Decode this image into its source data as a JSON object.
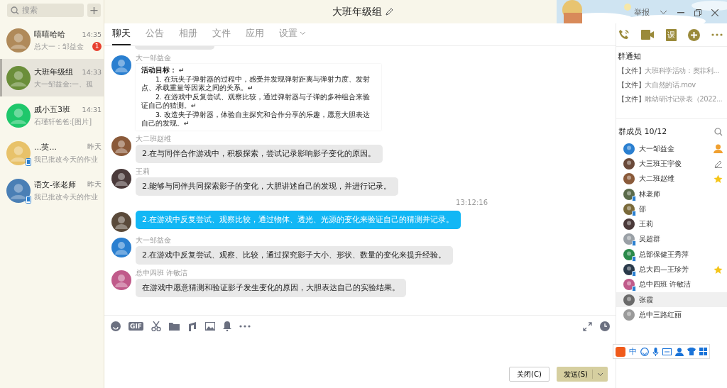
{
  "search": {
    "placeholder": "搜索",
    "add": "+"
  },
  "conversations": [
    {
      "name": "嘻嘻哈哈",
      "time": "14:35",
      "preview": "总大一：邹益金",
      "unread": "1",
      "selected": false,
      "mobile": false,
      "color": "#b08a5a"
    },
    {
      "name": "大班年级组",
      "time": "14:33",
      "preview": "大一邹益金:一、孤",
      "selected": true,
      "mobile": false,
      "color": "#6b8e3a"
    },
    {
      "name": "戚小五3班",
      "time": "14:31",
      "preview": "石瑾轩爸爸:[图片]",
      "selected": false,
      "mobile": false,
      "color": "#1fc76b"
    },
    {
      "name": "...英...",
      "time": "昨天",
      "preview": "我已批改今天的作业",
      "selected": false,
      "mobile": true,
      "color": "#e8c26a"
    },
    {
      "name": "语文-张老师",
      "time": "昨天",
      "preview": "我已批改今天的作业",
      "selected": false,
      "mobile": true,
      "color": "#4a7fb5"
    }
  ],
  "window": {
    "title": "大班年级组",
    "report": "举报"
  },
  "tabs": [
    {
      "label": "聊天",
      "selected": true
    },
    {
      "label": "公告",
      "selected": false
    },
    {
      "label": "相册",
      "selected": false
    },
    {
      "label": "文件",
      "selected": false
    },
    {
      "label": "应用",
      "selected": false
    },
    {
      "label": "设置",
      "selected": false,
      "dropdown": true
    }
  ],
  "header_actions": {
    "course": "课"
  },
  "messages": [
    {
      "kind": "document",
      "sender": "大一邹益金",
      "color": "#2a7fd0",
      "lines": [
        "**活动目标：** ↵",
        "1. 在玩夹子弹射器的过程中，感受并发现弹射距离与弹射力度、发射点、承载重量等因素之间的关系。↵",
        "2. 在游戏中反复尝试、观察比较，通过弹射器与子弹的多种组合来验证自己的猜测。↵",
        "3. 改造夹子弹射器，体验自主探究和合作分享的乐趣，愿意大胆表达自己的发现。↵"
      ]
    },
    {
      "kind": "text",
      "sender": "大二班赵维",
      "color": "#8a5a3a",
      "text": "2.在与同伴合作游戏中，积极探索，尝试记录影响影子变化的原因。"
    },
    {
      "kind": "text",
      "sender": "王莉",
      "color": "#4a3a3a",
      "text": "2.能够与同伴共同探索影子的变化，大胆讲述自己的发现，并进行记录。"
    },
    {
      "kind": "time",
      "text": "13:12:16"
    },
    {
      "kind": "self",
      "color": "#5a4a3a",
      "text": "2.在游戏中反复尝试、观察比较，通过物体、透光、光源的变化来验证自己的猜测并记录。"
    },
    {
      "kind": "text",
      "sender": "大一邹益金",
      "color": "#2a7fd0",
      "text": "2.在游戏中反复尝试、观察、比较，通过探究影子大小、形状、数量的变化来提升经验。"
    },
    {
      "kind": "text",
      "sender": "总中四班 许敏洁",
      "color": "#c05a8a",
      "text": "在游戏中愿意猜测和验证影子发生变化的原因，大胆表达自己的实验结果。"
    }
  ],
  "toolbar": {
    "gif": "GIF"
  },
  "buttons": {
    "close": "关闭(C)",
    "send": "发送(S)"
  },
  "notice": {
    "title": "群通知",
    "items": [
      {
        "tag": "【文件】",
        "text": "大班科学活动：奥菲利..."
      },
      {
        "tag": "【文件】",
        "text": "大自然的话.mov"
      },
      {
        "tag": "【文件】",
        "text": "雕幼研讨记录表（2022..."
      }
    ]
  },
  "members": {
    "title": "群成员 10/12",
    "list": [
      {
        "name": "大一邹益金",
        "kind": "owner",
        "mobile": false,
        "selected": false,
        "color": "#2a7fd0"
      },
      {
        "name": "大三班王宇俊",
        "kind": "editor",
        "mobile": false,
        "selected": false,
        "color": "#6a4a3a"
      },
      {
        "name": "大二班赵维",
        "kind": "admin",
        "mobile": false,
        "selected": false,
        "color": "#8a5a3a"
      },
      {
        "name": "林老师",
        "kind": "member",
        "mobile": true,
        "selected": false,
        "color": "#5a6a4a"
      },
      {
        "name": "邵",
        "kind": "member",
        "mobile": true,
        "selected": false,
        "color": "#7a6a3a"
      },
      {
        "name": "王莉",
        "kind": "member",
        "mobile": false,
        "selected": false,
        "color": "#4a3a3a"
      },
      {
        "name": "吴超群",
        "kind": "member",
        "mobile": true,
        "selected": false,
        "color": "#9aa0a6"
      },
      {
        "name": "总部保健王秀萍",
        "kind": "member",
        "mobile": true,
        "selected": false,
        "color": "#2a8a4a"
      },
      {
        "name": "总大四—王珍芳",
        "kind": "admin",
        "mobile": true,
        "selected": false,
        "color": "#2a3a4a"
      },
      {
        "name": "总中四班 许敏洁",
        "kind": "member",
        "mobile": true,
        "selected": false,
        "color": "#c05a8a"
      },
      {
        "name": "张霞",
        "kind": "member",
        "mobile": false,
        "selected": true,
        "color": "#6a6a6a"
      },
      {
        "name": "总中三路红丽",
        "kind": "member",
        "mobile": false,
        "selected": false,
        "color": "#9a9a9a"
      }
    ]
  },
  "ime": {
    "mode": "中"
  }
}
